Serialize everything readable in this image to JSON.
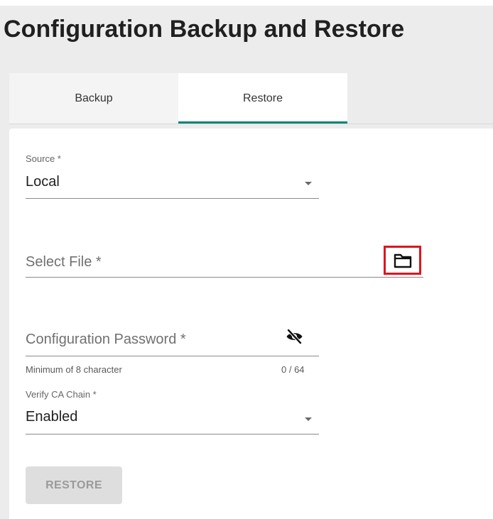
{
  "page": {
    "title": "Configuration Backup and Restore"
  },
  "tabs": [
    {
      "label": "Backup",
      "active": false
    },
    {
      "label": "Restore",
      "active": true
    }
  ],
  "form": {
    "source": {
      "label": "Source *",
      "value": "Local"
    },
    "select_file": {
      "placeholder": "Select File *"
    },
    "password": {
      "placeholder": "Configuration Password *",
      "hint": "Minimum of 8 character",
      "counter": "0 / 64"
    },
    "verify_ca": {
      "label": "Verify CA Chain *",
      "value": "Enabled"
    },
    "restore_button": {
      "label": "RESTORE",
      "disabled": true
    }
  },
  "icons": {
    "folder": "folder-icon",
    "visibility": "eye-off-icon",
    "dropdown": "chevron-down-icon"
  },
  "colors": {
    "accent": "#008476",
    "highlight_box": "#e0141f",
    "page_bg": "#ececec"
  }
}
